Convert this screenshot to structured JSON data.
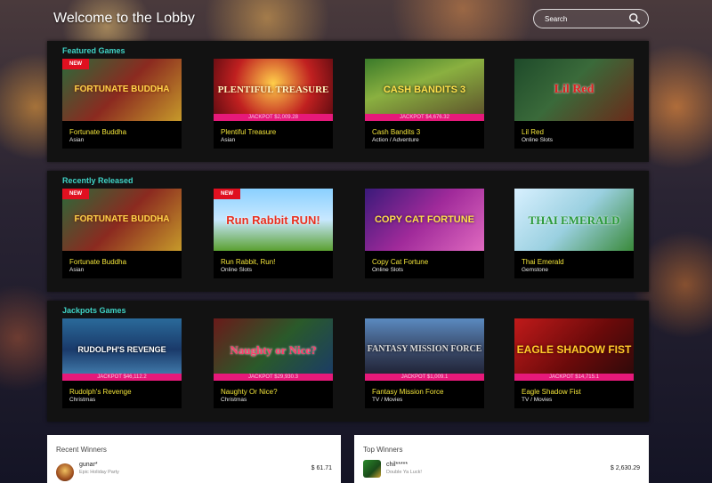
{
  "header": {
    "title": "Welcome to the Lobby",
    "search_placeholder": "Search"
  },
  "sections": [
    {
      "title": "Featured Games",
      "games": [
        {
          "name": "Fortunate Buddha",
          "category": "Asian",
          "badge": "NEW",
          "jackpot": "",
          "art": "FORTUNATE BUDDHA"
        },
        {
          "name": "Plentiful Treasure",
          "category": "Asian",
          "badge": "",
          "jackpot": "JACKPOT $2,009.28",
          "art": "PLENTIFUL TREASURE"
        },
        {
          "name": "Cash Bandits 3",
          "category": "Action / Adventure",
          "badge": "",
          "jackpot": "JACKPOT $4,676.32",
          "art": "CASH BANDITS 3"
        },
        {
          "name": "Lil Red",
          "category": "Online Slots",
          "badge": "",
          "jackpot": "",
          "art": "Lil Red"
        }
      ]
    },
    {
      "title": "Recently Released",
      "games": [
        {
          "name": "Fortunate Buddha",
          "category": "Asian",
          "badge": "NEW",
          "jackpot": "",
          "art": "FORTUNATE BUDDHA"
        },
        {
          "name": "Run Rabbit, Run!",
          "category": "Online Slots",
          "badge": "NEW",
          "jackpot": "",
          "art": "Run Rabbit RUN!"
        },
        {
          "name": "Copy Cat Fortune",
          "category": "Online Slots",
          "badge": "",
          "jackpot": "",
          "art": "COPY CAT FORTUNE"
        },
        {
          "name": "Thai Emerald",
          "category": "Gemstone",
          "badge": "",
          "jackpot": "",
          "art": "THAI EMERALD"
        }
      ]
    },
    {
      "title": "Jackpots Games",
      "games": [
        {
          "name": "Rudolph's Revenge",
          "category": "Christmas",
          "badge": "",
          "jackpot": "JACKPOT $46,112.2",
          "art": "RUDOLPH'S REVENGE"
        },
        {
          "name": "Naughty Or Nice?",
          "category": "Christmas",
          "badge": "",
          "jackpot": "JACKPOT $29,930.3",
          "art": "Naughty or Nice?"
        },
        {
          "name": "Fantasy Mission Force",
          "category": "TV / Movies",
          "badge": "",
          "jackpot": "JACKPOT $1,009.1",
          "art": "FANTASY MISSION FORCE"
        },
        {
          "name": "Eagle Shadow Fist",
          "category": "TV / Movies",
          "badge": "",
          "jackpot": "JACKPOT $14,715.1",
          "art": "EAGLE SHADOW FIST"
        }
      ]
    }
  ],
  "recent_winners": {
    "title": "Recent Winners",
    "name": "gunar*",
    "game": "Epic Holiday Party",
    "amount": "$ 61.71"
  },
  "top_winners": {
    "title": "Top Winners",
    "name": "chil*****",
    "game": "Double Ya Luck!",
    "amount": "$ 2,630.29"
  },
  "colors": {
    "section_title": "#3fd3c6",
    "game_name": "#f2e43a",
    "jackpot_bar": "#e6197a",
    "new_badge": "#e01020"
  }
}
